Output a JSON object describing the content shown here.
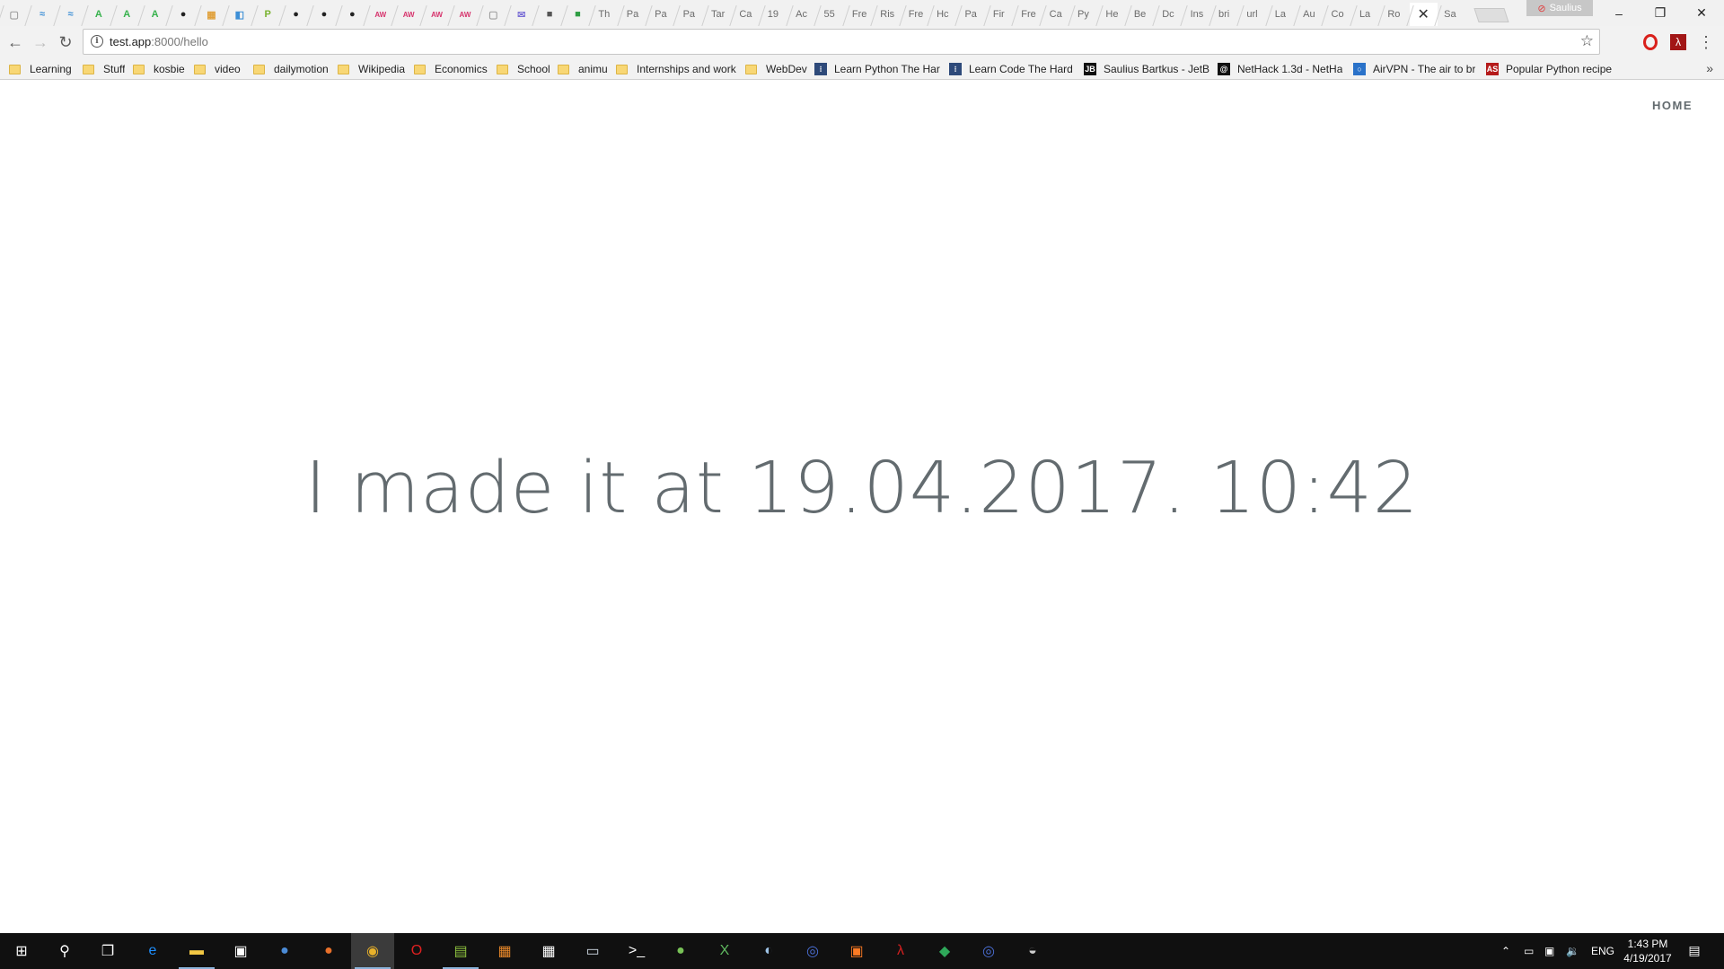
{
  "tabs": [
    {
      "glyph": "▢",
      "text": "",
      "color": "#9e9e9e"
    },
    {
      "glyph": "≈",
      "text": "",
      "color": "#3d8fd6"
    },
    {
      "glyph": "≈",
      "text": "",
      "color": "#3d8fd6"
    },
    {
      "glyph": "A",
      "text": "",
      "color": "#37b24d"
    },
    {
      "glyph": "A",
      "text": "",
      "color": "#37b24d"
    },
    {
      "glyph": "A",
      "text": "",
      "color": "#37b24d"
    },
    {
      "glyph": "●",
      "text": "",
      "color": "#222222"
    },
    {
      "glyph": "▦",
      "text": "",
      "color": "#e0a03a"
    },
    {
      "glyph": "◧",
      "text": "",
      "color": "#3d8fd6"
    },
    {
      "glyph": "P",
      "text": "",
      "color": "#79b330"
    },
    {
      "glyph": "●",
      "text": "",
      "color": "#222222"
    },
    {
      "glyph": "●",
      "text": "",
      "color": "#222222"
    },
    {
      "glyph": "●",
      "text": "",
      "color": "#222222"
    },
    {
      "glyph": "AW",
      "text": "",
      "color": "#d6336c"
    },
    {
      "glyph": "AW",
      "text": "",
      "color": "#d6336c"
    },
    {
      "glyph": "AW",
      "text": "",
      "color": "#d6336c"
    },
    {
      "glyph": "AW",
      "text": "",
      "color": "#d6336c"
    },
    {
      "glyph": "▢",
      "text": "",
      "color": "#9e9e9e"
    },
    {
      "glyph": "✉",
      "text": "",
      "color": "#7b6fd6"
    },
    {
      "glyph": "■",
      "text": "",
      "color": "#555555"
    },
    {
      "glyph": "■",
      "text": "",
      "color": "#2f9e44"
    },
    {
      "glyph": "",
      "text": "Th"
    },
    {
      "glyph": "",
      "text": "Pa"
    },
    {
      "glyph": "",
      "text": "Pa"
    },
    {
      "glyph": "",
      "text": "Pa"
    },
    {
      "glyph": "",
      "text": "Tar"
    },
    {
      "glyph": "",
      "text": "Ca"
    },
    {
      "glyph": "",
      "text": "19"
    },
    {
      "glyph": "",
      "text": "Ac"
    },
    {
      "glyph": "",
      "text": "55"
    },
    {
      "glyph": "",
      "text": "Fre"
    },
    {
      "glyph": "",
      "text": "Ris"
    },
    {
      "glyph": "",
      "text": "Fre"
    },
    {
      "glyph": "",
      "text": "Hc"
    },
    {
      "glyph": "",
      "text": "Pa"
    },
    {
      "glyph": "",
      "text": "Fir"
    },
    {
      "glyph": "",
      "text": "Fre"
    },
    {
      "glyph": "",
      "text": "Ca"
    },
    {
      "glyph": "",
      "text": "Py"
    },
    {
      "glyph": "",
      "text": "He"
    },
    {
      "glyph": "",
      "text": "Be"
    },
    {
      "glyph": "",
      "text": "Dc"
    },
    {
      "glyph": "",
      "text": "Ins"
    },
    {
      "glyph": "",
      "text": "bri"
    },
    {
      "glyph": "",
      "text": "url"
    },
    {
      "glyph": "",
      "text": "La"
    },
    {
      "glyph": "",
      "text": "Au"
    },
    {
      "glyph": "",
      "text": "Co"
    },
    {
      "glyph": "",
      "text": "La"
    },
    {
      "glyph": "",
      "text": "Ro"
    },
    {
      "glyph": "✕",
      "text": "",
      "active": true
    },
    {
      "glyph": "",
      "text": "Sa"
    }
  ],
  "profile": {
    "name": "Saulius"
  },
  "window_controls": {
    "minimize": "–",
    "restore": "❐",
    "close": "✕"
  },
  "toolbar": {
    "back": "←",
    "forward": "→",
    "reload": "↻",
    "menu": "⋮"
  },
  "address": {
    "host": "test.app",
    "rest": ":8000/hello",
    "info": "i",
    "star": "☆"
  },
  "bookmarks": [
    {
      "type": "folder",
      "label": "Learning"
    },
    {
      "type": "folder",
      "label": "Stuff"
    },
    {
      "type": "folder",
      "label": "kosbie"
    },
    {
      "type": "folder",
      "label": "video"
    },
    {
      "type": "folder",
      "label": "dailymotion"
    },
    {
      "type": "folder",
      "label": "Wikipedia"
    },
    {
      "type": "folder",
      "label": "Economics"
    },
    {
      "type": "folder",
      "label": "School"
    },
    {
      "type": "folder",
      "label": "animu"
    },
    {
      "type": "folder",
      "label": "Internships and work"
    },
    {
      "type": "folder",
      "label": "WebDev"
    },
    {
      "type": "link",
      "label": "Learn Python The Har",
      "glyph": "⁝",
      "color": "#2e4a7a"
    },
    {
      "type": "link",
      "label": "Learn Code The Hard",
      "glyph": "⁝",
      "color": "#2e4a7a"
    },
    {
      "type": "link",
      "label": "Saulius Bartkus - JetB",
      "glyph": "JB",
      "color": "#111111"
    },
    {
      "type": "link",
      "label": "NetHack 1.3d - NetHa",
      "glyph": "@",
      "color": "#111111"
    },
    {
      "type": "link",
      "label": "AirVPN - The air to br",
      "glyph": "○",
      "color": "#2a72c9"
    },
    {
      "type": "link",
      "label": "Popular Python recipe",
      "glyph": "AS",
      "color": "#b51b1b"
    }
  ],
  "bookmarks_overflow": "»",
  "page": {
    "nav": {
      "home": "HOME"
    },
    "heading": "I made it at 19.04.2017. 10:42"
  },
  "taskbar": {
    "apps": [
      {
        "name": "start",
        "glyph": "⊞",
        "color": "#ffffff"
      },
      {
        "name": "search",
        "glyph": "⚲",
        "color": "#ffffff"
      },
      {
        "name": "task-view",
        "glyph": "❐",
        "color": "#ffffff"
      },
      {
        "name": "edge",
        "glyph": "e",
        "color": "#1e90ff"
      },
      {
        "name": "file-explorer",
        "glyph": "▬",
        "color": "#f2c744",
        "running": true
      },
      {
        "name": "store",
        "glyph": "▣",
        "color": "#ffffff"
      },
      {
        "name": "thunderbird",
        "glyph": "●",
        "color": "#4b8bd6"
      },
      {
        "name": "firefox",
        "glyph": "●",
        "color": "#e8702a"
      },
      {
        "name": "chrome",
        "glyph": "◉",
        "color": "#e8b12a",
        "running": true,
        "active": true
      },
      {
        "name": "opera",
        "glyph": "O",
        "color": "#e02020"
      },
      {
        "name": "notepadpp",
        "glyph": "▤",
        "color": "#8fc43f",
        "running": true
      },
      {
        "name": "sublime",
        "glyph": "▦",
        "color": "#e8882a"
      },
      {
        "name": "calculator",
        "glyph": "▦",
        "color": "#ffffff"
      },
      {
        "name": "photos",
        "glyph": "▭",
        "color": "#cfd8e3"
      },
      {
        "name": "terminal",
        "glyph": ">_",
        "color": "#ffffff"
      },
      {
        "name": "android-studio",
        "glyph": "●",
        "color": "#78c257"
      },
      {
        "name": "xming",
        "glyph": "X",
        "color": "#5fb85f"
      },
      {
        "name": "steam",
        "glyph": "◐",
        "color": "#9ec3e6"
      },
      {
        "name": "vpn-client",
        "glyph": "◎",
        "color": "#4b6fd6"
      },
      {
        "name": "xampp",
        "glyph": "▣",
        "color": "#fb7a24"
      },
      {
        "name": "acrobat",
        "glyph": "λ",
        "color": "#d42020"
      },
      {
        "name": "git-tool",
        "glyph": "◆",
        "color": "#2fa85a"
      },
      {
        "name": "globe-app",
        "glyph": "◎",
        "color": "#4b6fd6"
      },
      {
        "name": "python",
        "glyph": "◒",
        "color": "#cfcfcf"
      }
    ],
    "tray": {
      "chevron": "⌃",
      "battery": "▭",
      "network": "▣",
      "volume": "🔉",
      "lang": "ENG"
    },
    "clock": {
      "time": "1:43 PM",
      "date": "4/19/2017"
    },
    "notifications": "▤"
  }
}
